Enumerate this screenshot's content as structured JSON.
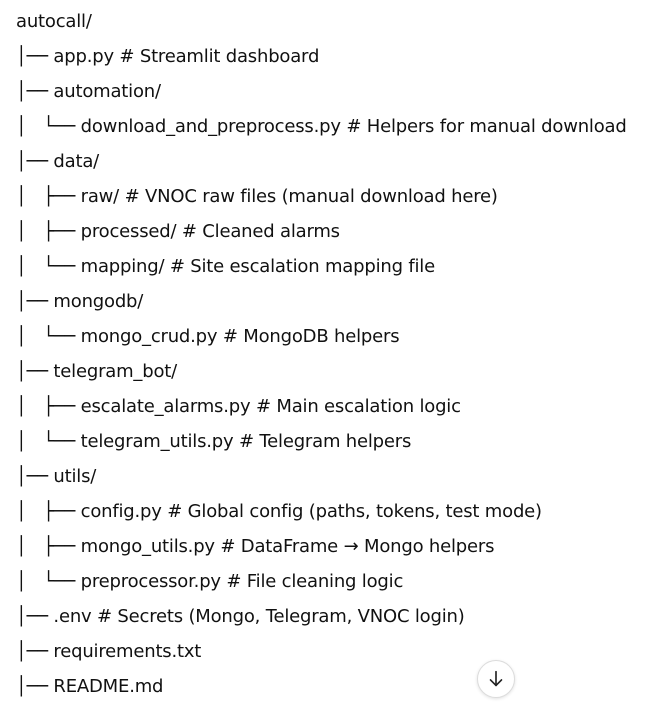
{
  "tree": {
    "lines": [
      "autocall/",
      "│── app.py # Streamlit dashboard",
      "│── automation/",
      "│   └── download_and_preprocess.py # Helpers for manual download",
      "│── data/",
      "│   ├── raw/ # VNOC raw files (manual download here)",
      "│   ├── processed/ # Cleaned alarms",
      "│   └── mapping/ # Site escalation mapping file",
      "│── mongodb/",
      "│   └── mongo_crud.py # MongoDB helpers",
      "│── telegram_bot/",
      "│   ├── escalate_alarms.py # Main escalation logic",
      "│   └── telegram_utils.py # Telegram helpers",
      "│── utils/",
      "│   ├── config.py # Global config (paths, tokens, test mode)",
      "│   ├── mongo_utils.py # DataFrame → Mongo helpers",
      "│   └── preprocessor.py # File cleaning logic",
      "│── .env # Secrets (Mongo, Telegram, VNOC login)",
      "│── requirements.txt",
      "│── README.md"
    ]
  },
  "scroll_button": {
    "icon": "arrow-down-icon"
  }
}
